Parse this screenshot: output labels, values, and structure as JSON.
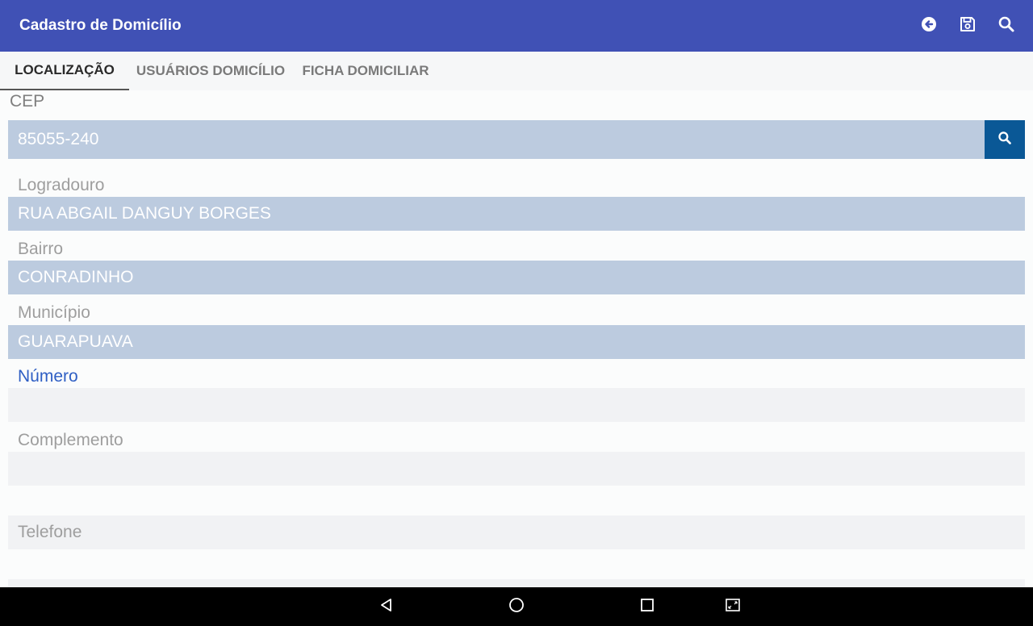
{
  "appbar": {
    "title": "Cadastro de Domicílio",
    "actions": [
      {
        "icon": "back-circle-icon"
      },
      {
        "icon": "save-icon"
      },
      {
        "icon": "search-icon"
      }
    ],
    "color": "#4051b5"
  },
  "tabs": [
    {
      "label": "LOCALIZAÇÃO",
      "active": true
    },
    {
      "label": "USUÁRIOS DOMICÍLIO",
      "active": false
    },
    {
      "label": "FICHA DOMICILIAR",
      "active": false
    }
  ],
  "form": {
    "cep": {
      "label": "CEP",
      "value": "85055-240"
    },
    "logradouro": {
      "label": "Logradouro",
      "value": "RUA ABGAIL DANGUY BORGES"
    },
    "bairro": {
      "label": "Bairro",
      "value": "CONRADINHO"
    },
    "municipio": {
      "label": "Município",
      "value": "GUARAPUAVA"
    },
    "numero": {
      "label": "Número",
      "value": ""
    },
    "complemento": {
      "label": "Complemento",
      "value": ""
    },
    "telefone": {
      "label": "Telefone",
      "value": ""
    }
  },
  "navbar": {
    "buttons": [
      "back-triangle-icon",
      "home-circle-icon",
      "recents-square-icon",
      "screenshot-icon"
    ]
  }
}
